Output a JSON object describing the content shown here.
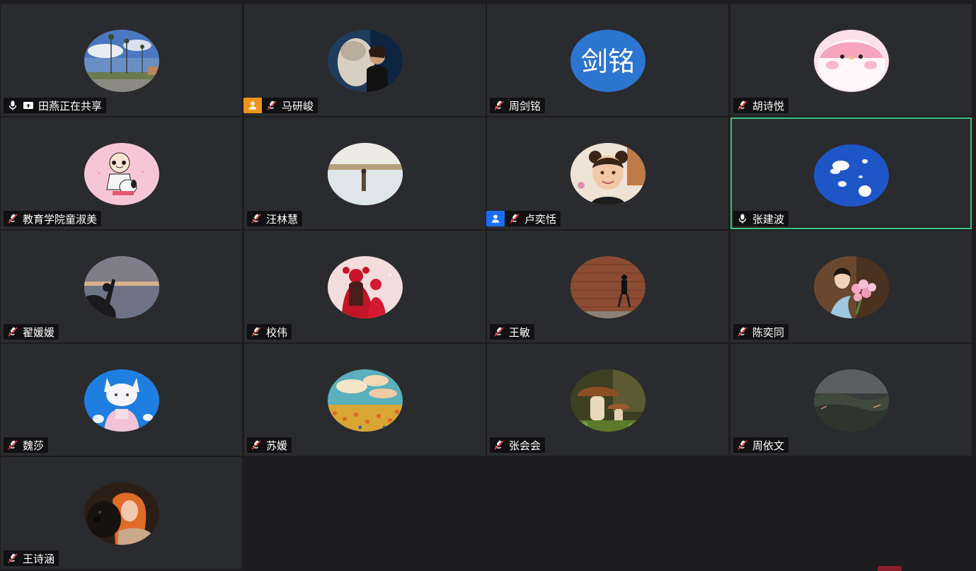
{
  "participants": [
    {
      "name": "田燕正在共享",
      "mic": "on",
      "sharing": true,
      "badge": null,
      "avatar": "palm-street-photo"
    },
    {
      "name": "马研峻",
      "mic": "muted",
      "sharing": false,
      "badge": {
        "color": "#f0931c",
        "icon": "person-icon"
      },
      "avatar": "statue-photo"
    },
    {
      "name": "周剑铭",
      "mic": "muted",
      "sharing": false,
      "badge": null,
      "avatar": "text-avatar",
      "avatar_text": "剑铭",
      "avatar_color": "#2c75d0"
    },
    {
      "name": "胡诗悦",
      "mic": "muted",
      "sharing": false,
      "badge": null,
      "avatar": "pink-chick-cartoon"
    },
    {
      "name": "教育学院童淑美",
      "mic": "muted",
      "sharing": false,
      "badge": null,
      "avatar": "snoopy-cartoon"
    },
    {
      "name": "汪林慧",
      "mic": "muted",
      "sharing": false,
      "badge": null,
      "avatar": "white-landscape-photo"
    },
    {
      "name": "卢奕恬",
      "mic": "muted",
      "sharing": false,
      "badge": {
        "color": "#1a6dff",
        "icon": "person-icon"
      },
      "avatar": "girl-photo"
    },
    {
      "name": "张建波",
      "mic": "on",
      "sharing": false,
      "badge": null,
      "avatar": "blue-sky-clouds",
      "active": true
    },
    {
      "name": "翟媛媛",
      "mic": "muted",
      "sharing": false,
      "badge": null,
      "avatar": "silhouette-sunset"
    },
    {
      "name": "校伟",
      "mic": "muted",
      "sharing": false,
      "badge": null,
      "avatar": "red-cartoon-girls"
    },
    {
      "name": "王敏",
      "mic": "muted",
      "sharing": false,
      "badge": null,
      "avatar": "brick-wall-walker"
    },
    {
      "name": "陈奕同",
      "mic": "muted",
      "sharing": false,
      "badge": null,
      "avatar": "flowers-girl"
    },
    {
      "name": "魏莎",
      "mic": "muted",
      "sharing": false,
      "badge": null,
      "avatar": "anime-cat"
    },
    {
      "name": "苏媛",
      "mic": "muted",
      "sharing": false,
      "badge": null,
      "avatar": "flower-field-painting"
    },
    {
      "name": "张会会",
      "mic": "muted",
      "sharing": false,
      "badge": null,
      "avatar": "mushroom-photo"
    },
    {
      "name": "周依文",
      "mic": "muted",
      "sharing": false,
      "badge": null,
      "avatar": "misty-mountains"
    },
    {
      "name": "王诗涵",
      "mic": "muted",
      "sharing": false,
      "badge": null,
      "avatar": "woman-with-dog"
    }
  ],
  "colors": {
    "tile_bg": "#2a2b2e",
    "page_bg": "#1d1d1f",
    "active_border": "#3bc27e",
    "namebar_text": "#ffffff"
  }
}
